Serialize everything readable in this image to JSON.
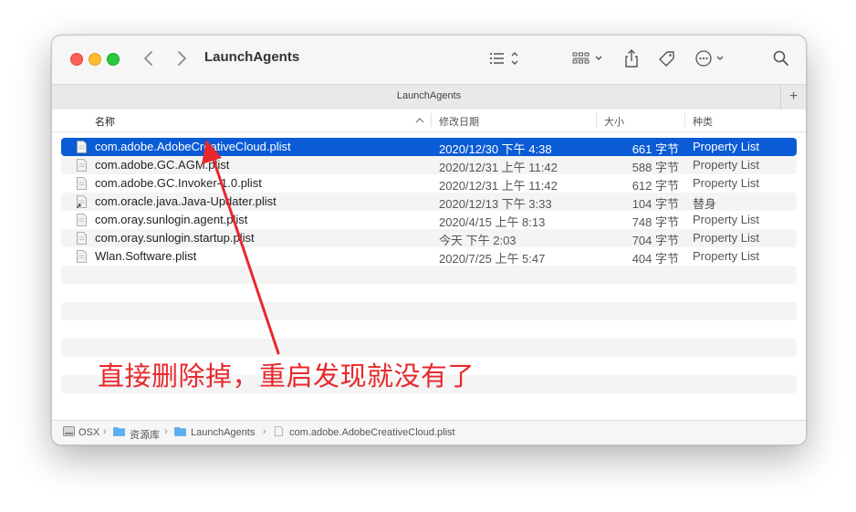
{
  "window": {
    "title": "LaunchAgents",
    "tab_label": "LaunchAgents",
    "tab_add": "+"
  },
  "toolbar": {
    "icons": [
      "back-icon",
      "forward-icon",
      "list-view-icon",
      "grid-view-icon",
      "share-icon",
      "tag-icon",
      "more-icon",
      "search-icon"
    ]
  },
  "columns": {
    "name": "名称",
    "date": "修改日期",
    "size": "大小",
    "kind": "种类"
  },
  "files": [
    {
      "name": "com.adobe.AdobeCreativeCloud.plist",
      "date": "2020/12/30 下午 4:38",
      "size": "661 字节",
      "kind": "Property List"
    },
    {
      "name": "com.adobe.GC.AGM.plist",
      "date": "2020/12/31 上午 11:42",
      "size": "588 字节",
      "kind": "Property List"
    },
    {
      "name": "com.adobe.GC.Invoker-1.0.plist",
      "date": "2020/12/31 上午 11:42",
      "size": "612 字节",
      "kind": "Property List"
    },
    {
      "name": "com.oracle.java.Java-Updater.plist",
      "date": "2020/12/13 下午 3:33",
      "size": "104 字节",
      "kind": "替身"
    },
    {
      "name": "com.oray.sunlogin.agent.plist",
      "date": "2020/4/15 上午 8:13",
      "size": "748 字节",
      "kind": "Property List"
    },
    {
      "name": "com.oray.sunlogin.startup.plist",
      "date": "今天 下午 2:03",
      "size": "704 字节",
      "kind": "Property List"
    },
    {
      "name": "Wlan.Software.plist",
      "date": "2020/7/25 上午 5:47",
      "size": "404 字节",
      "kind": "Property List"
    }
  ],
  "selected_index": 0,
  "pathbar": {
    "items": [
      "OSX",
      "资源库",
      "LaunchAgents",
      "com.adobe.AdobeCreativeCloud.plist"
    ],
    "separator": "›"
  },
  "annotation": {
    "text": "直接删除掉，重启发现就没有了",
    "color": "#e8282c"
  },
  "colors": {
    "selection": "#0a5bd5",
    "close": "#fe5f57",
    "minimize": "#febc2e",
    "maximize": "#28c840"
  }
}
